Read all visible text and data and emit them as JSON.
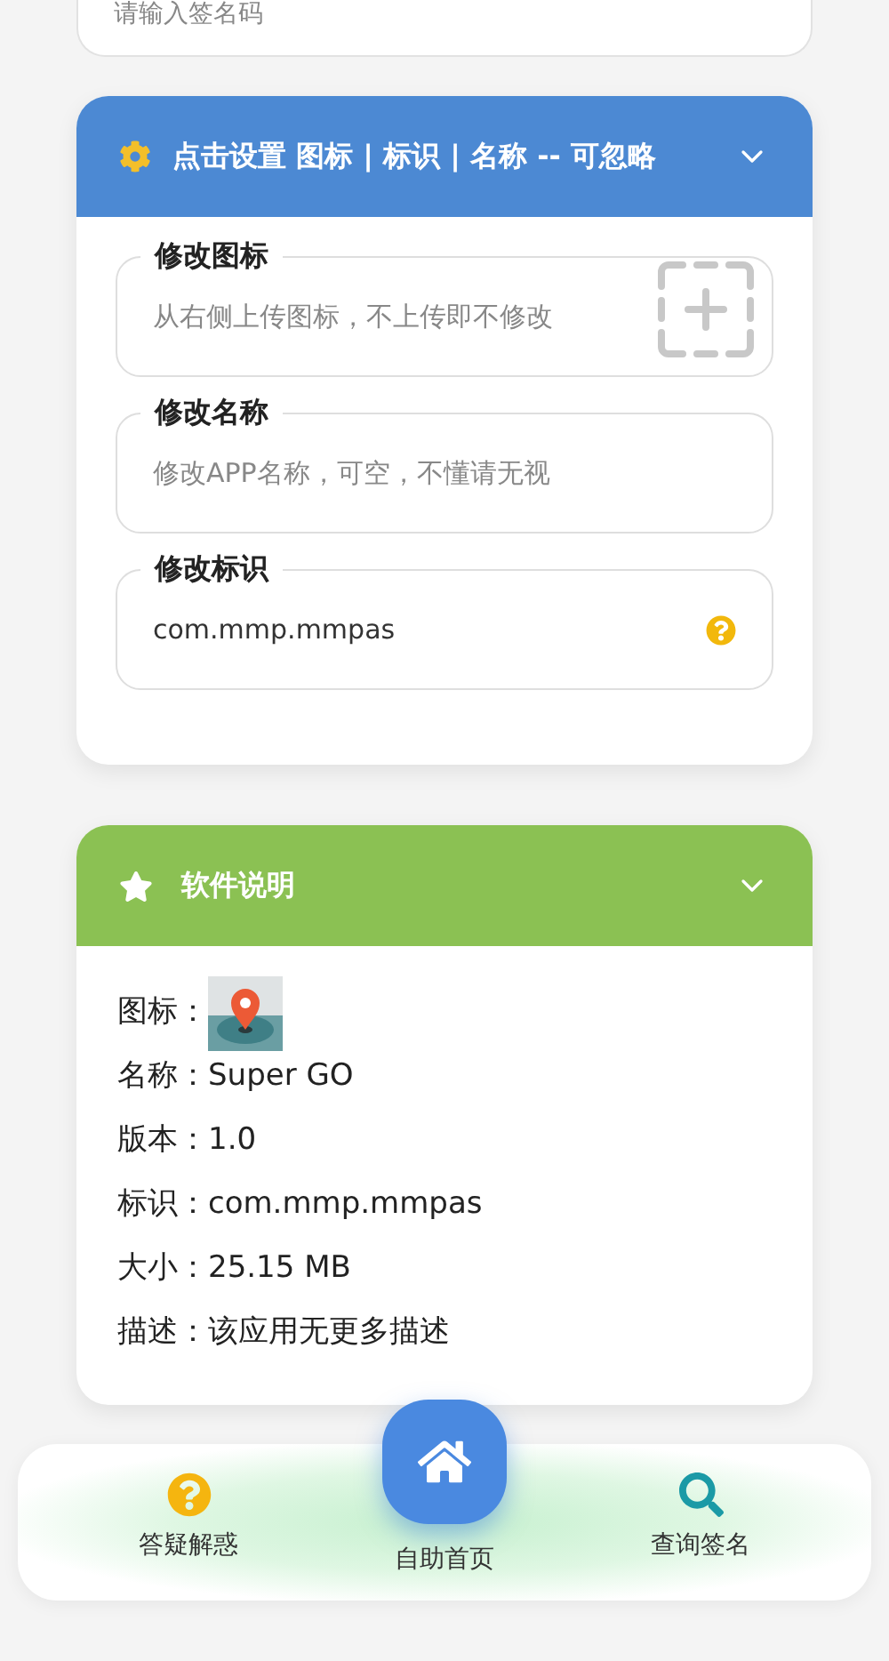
{
  "signature_field": {
    "placeholder": "请输入签名码"
  },
  "settings_panel": {
    "title": "点击设置 图标 | 标识 | 名称 -- 可忽略",
    "expanded": true,
    "fields": [
      {
        "kind": "upload",
        "label": "修改图标",
        "placeholder": "从右侧上传图标，不上传即不修改"
      },
      {
        "kind": "text",
        "label": "修改名称",
        "placeholder": "修改APP名称，可空，不懂请无视"
      },
      {
        "kind": "help",
        "label": "修改标识",
        "value": "com.mmp.mmpas"
      }
    ]
  },
  "info_panel": {
    "title": "软件说明",
    "expanded": true,
    "rows": [
      {
        "kind": "image",
        "label": "图标："
      },
      {
        "kind": "text",
        "label": "名称：",
        "value": "Super GO"
      },
      {
        "kind": "text",
        "label": "版本：",
        "value": "1.0"
      },
      {
        "kind": "text",
        "label": "标识：",
        "value": "com.mmp.mmpas"
      },
      {
        "kind": "text",
        "label": "大小：",
        "value": "25.15 MB"
      },
      {
        "kind": "text",
        "label": "描述：",
        "value": "该应用无更多描述"
      }
    ]
  },
  "bottom_nav": [
    {
      "kind": "help",
      "label": "答疑解惑",
      "selected": false
    },
    {
      "kind": "home",
      "label": "自助首页",
      "selected": true
    },
    {
      "kind": "search",
      "label": "查询签名",
      "selected": false
    }
  ]
}
